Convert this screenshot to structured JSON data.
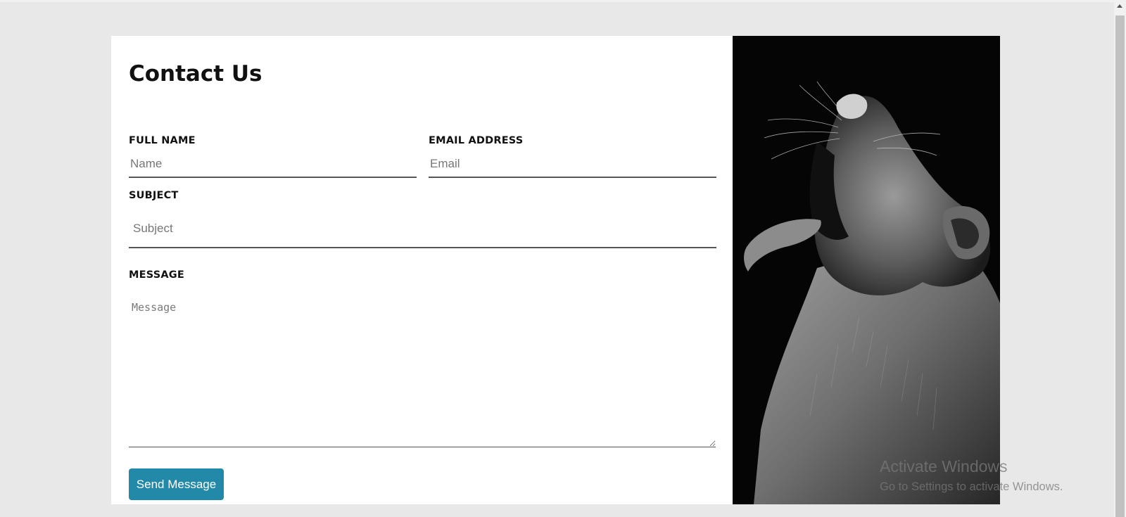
{
  "form": {
    "title": "Contact Us",
    "full_name": {
      "label": "FULL NAME",
      "placeholder": "Name",
      "value": ""
    },
    "email": {
      "label": "EMAIL ADDRESS",
      "placeholder": "Email",
      "value": ""
    },
    "subject": {
      "label": "SUBJECT",
      "placeholder": "Subject",
      "value": ""
    },
    "message": {
      "label": "MESSAGE",
      "placeholder": "Message",
      "value": ""
    },
    "submit_label": "Send Message",
    "accent_color": "#228aa8"
  },
  "image": {
    "subject": "lioness-roaring-photo"
  },
  "watermark": {
    "title": "Activate Windows",
    "subtitle": "Go to Settings to activate Windows."
  }
}
